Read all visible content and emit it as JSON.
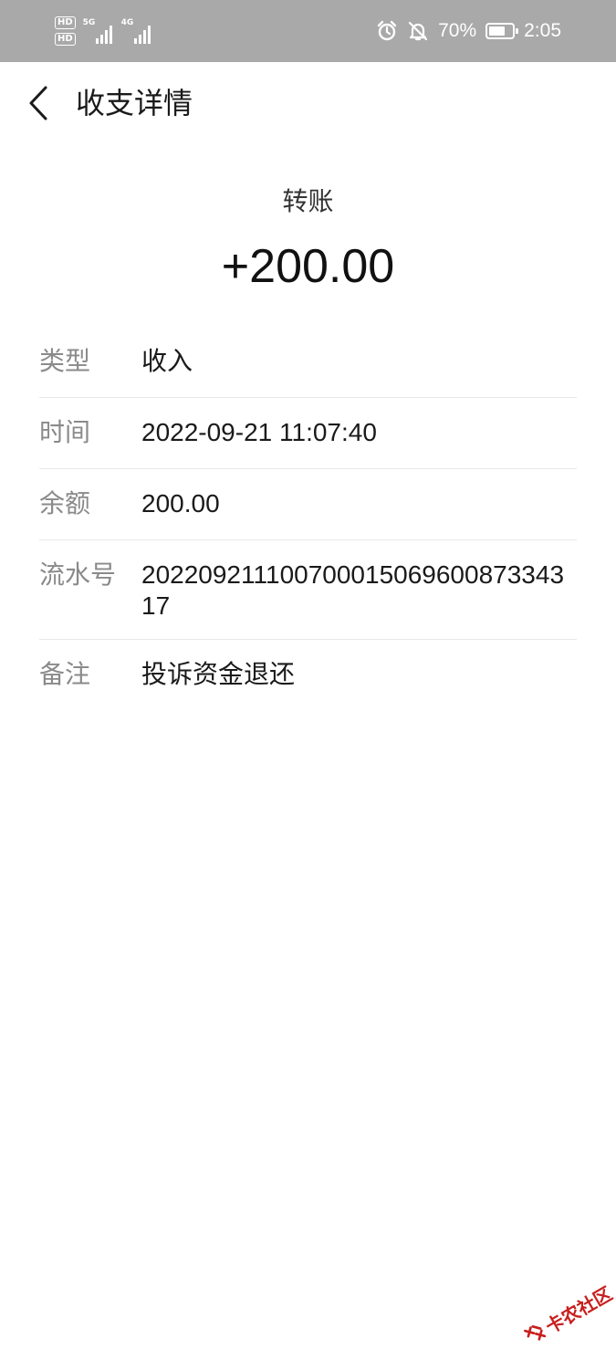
{
  "status_bar": {
    "hd1": "HD",
    "hd2": "HD",
    "net1": "5G",
    "net2": "4G",
    "battery_percent": "70%",
    "battery_level": 0.7,
    "time": "2:05",
    "icons": [
      "alarm-icon",
      "mute-bell-icon",
      "battery-icon",
      "signal-icon"
    ]
  },
  "header": {
    "title": "收支详情",
    "back_icon": "chevron-left-icon"
  },
  "summary": {
    "type": "转账",
    "amount": "+200.00"
  },
  "details": [
    {
      "label": "类型",
      "value": "收入"
    },
    {
      "label": "时间",
      "value": "2022-09-21 11:07:40"
    },
    {
      "label": "余额",
      "value": "200.00"
    },
    {
      "label": "流水号",
      "value": "20220921110070001506960087334317"
    },
    {
      "label": "备注",
      "value": "投诉资金退还"
    }
  ],
  "watermark": {
    "text": "卡农社区"
  },
  "colors": {
    "status_bar_bg": "#a9a9a9",
    "label": "#8a8a8a",
    "text": "#1a1a1a",
    "divider": "#e8e8e8",
    "watermark": "#c81e1e"
  }
}
